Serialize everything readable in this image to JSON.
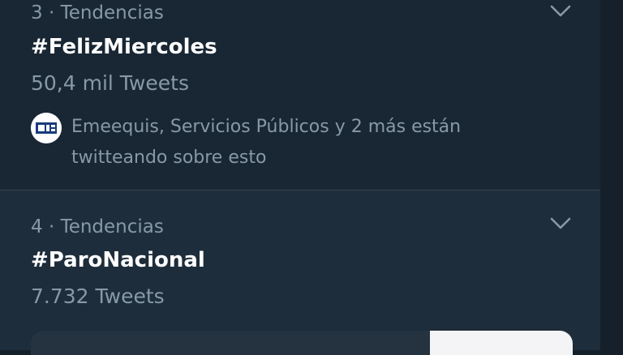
{
  "trends": [
    {
      "meta": "3 · Tendencias",
      "hashtag": "#FelizMiercoles",
      "count": "50,4 mil Tweets",
      "context": "Emeequis, Servicios Públicos y 2 más están twitteando sobre esto",
      "context_avatar_icon": "newspaper-logo-icon"
    },
    {
      "meta": "4 · Tendencias",
      "hashtag": "#ParoNacional",
      "count": "7.732 Tweets"
    }
  ],
  "colors": {
    "background": "#192734",
    "hover_background": "#1e2d3b",
    "primary_text": "#ffffff",
    "secondary_text": "#8899a6",
    "divider": "#38444d"
  },
  "icons": {
    "more": "chevron-down-icon"
  }
}
